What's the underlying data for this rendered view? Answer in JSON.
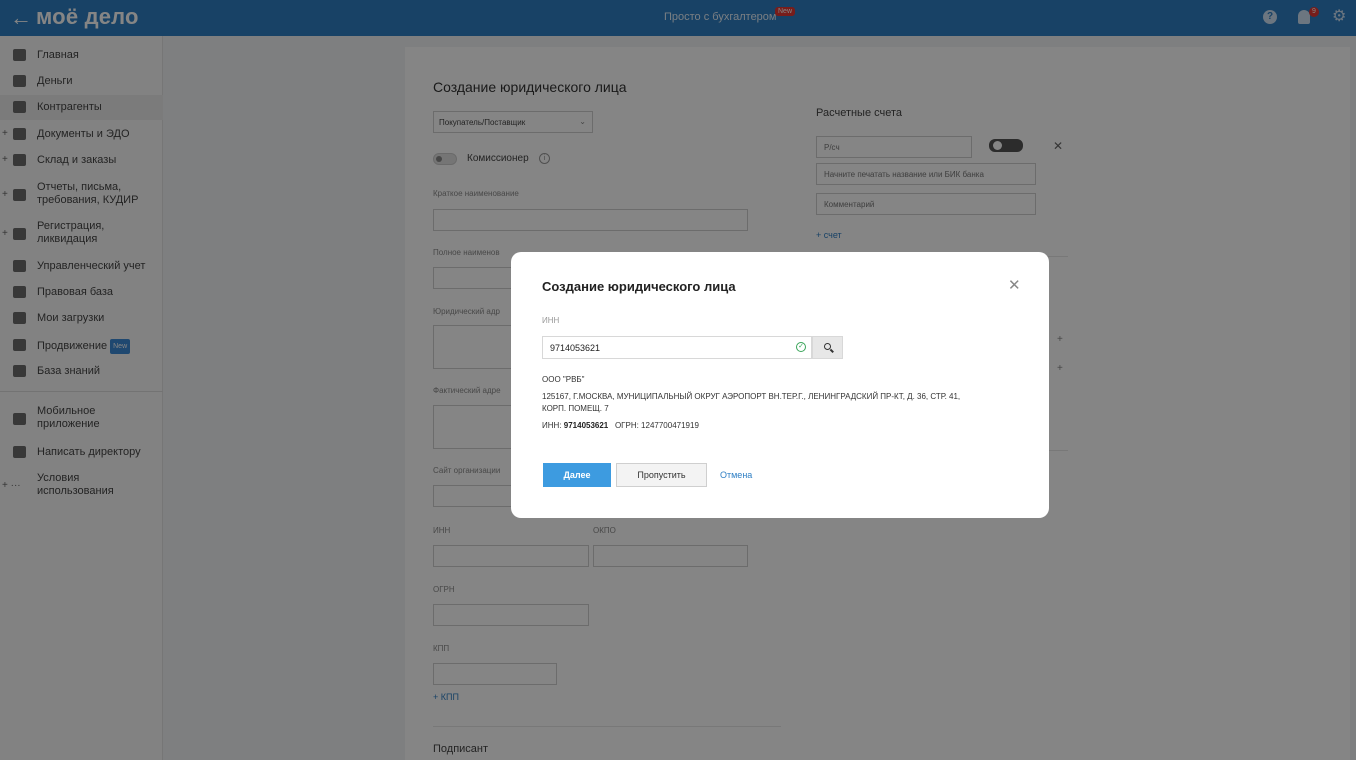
{
  "topbar": {
    "back_glyph": "←",
    "logo": "моё дело",
    "center_text": "Просто с бухгалтером",
    "new_tag": "New",
    "help_glyph": "?",
    "notification_count": "9",
    "gear_glyph": "⚙"
  },
  "sidebar": {
    "items": [
      {
        "label": "Главная",
        "icon": "home-icon"
      },
      {
        "label": "Деньги",
        "icon": "money-icon"
      },
      {
        "label": "Контрагенты",
        "icon": "contractors-icon"
      },
      {
        "label": "Документы и ЭДО",
        "icon": "documents-icon"
      },
      {
        "label": "Склад и заказы",
        "icon": "warehouse-icon"
      },
      {
        "label": "Отчеты, письма,\nтребования, КУДИР",
        "icon": "reports-icon"
      },
      {
        "label": "Регистрация,\nликвидация",
        "icon": "registration-icon"
      },
      {
        "label": "Управленческий учет",
        "icon": "management-icon"
      },
      {
        "label": "Правовая база",
        "icon": "legal-icon"
      },
      {
        "label": "Мои загрузки",
        "icon": "folder-icon"
      },
      {
        "label": "Продвижение",
        "icon": "promo-icon",
        "badge": "New"
      },
      {
        "label": "База знаний",
        "icon": "knowledge-icon"
      },
      {
        "label": "Мобильное\nприложение",
        "icon": "mobile-icon"
      },
      {
        "label": "Написать директору",
        "icon": "message-icon"
      },
      {
        "label": "Условия\nиспользования",
        "icon": "terms-icon"
      }
    ],
    "plus_glyph": "+",
    "more_glyph": "+ ···"
  },
  "form": {
    "title": "Создание юридического лица",
    "type_select": "Покупатель/Поставщик",
    "commissioner_label": "Комиссионер",
    "short_name_label": "Краткое наименование",
    "full_name_label": "Полное наименов",
    "legal_address_label": "Юридический адр",
    "actual_address_label": "Фактический адре",
    "website_label": "Сайт организации",
    "inn_label": "ИНН",
    "okpo_label": "ОКПО",
    "ogrn_label": "ОГРН",
    "kpp_label": "КПП",
    "add_kpp": "+ КПП",
    "signer_title": "Подписант",
    "accounts_title": "Расчетные счета",
    "account_placeholder": "Р/сч",
    "bank_placeholder": "Начните печатать название или БИК банка",
    "comment_placeholder": "Комментарий",
    "add_account": "+ счет",
    "close_glyph": "✕",
    "plus_glyph": "+"
  },
  "modal": {
    "title": "Создание юридического лица",
    "close_glyph": "✕",
    "inn_label": "ИНН",
    "inn_value": "9714053621",
    "check_glyph": "✓",
    "org_name": "ООО \"РВБ\"",
    "address": "125167, Г.МОСКВА, МУНИЦИПАЛЬНЫЙ ОКРУГ АЭРОПОРТ ВН.ТЕР.Г., ЛЕНИНГРАДСКИЙ ПР-КТ, Д. 36, СТР. 41, КОРП. ПОМЕЩ. 7",
    "inn_prefix": "ИНН:",
    "inn_bold": "9714053621",
    "ogrn_text": "ОГРН: 1247700471919",
    "next_button": "Далее",
    "skip_button": "Пропустить",
    "cancel_link": "Отмена"
  }
}
